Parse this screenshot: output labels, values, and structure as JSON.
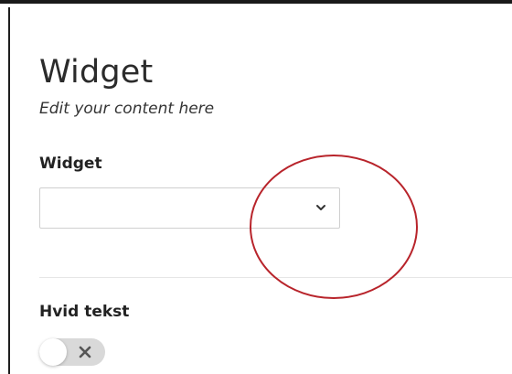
{
  "header": {
    "title": "Widget",
    "subtitle": "Edit your content here"
  },
  "widget_field": {
    "label": "Widget",
    "selected_value": ""
  },
  "text_toggle": {
    "label": "Hvid tekst",
    "state": "off"
  },
  "colors": {
    "annotation": "#b8242b",
    "toggle_track": "#d9d9d9"
  },
  "icons": {
    "select": "chevron-down-icon",
    "toggle": "close-icon"
  }
}
